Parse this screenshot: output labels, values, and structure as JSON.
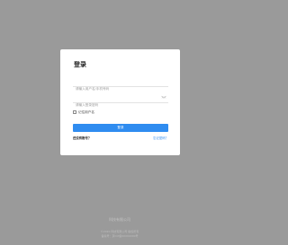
{
  "login": {
    "title": "登录",
    "account_placeholder": "请输入用户名/手机号码",
    "password_placeholder": "请输入登录密码",
    "remember_label": "记住用户名",
    "login_button": "登录",
    "register_prompt": "还没有账号？",
    "forgot_link": "忘记密码？"
  },
  "footer": {
    "brand": "科技有限公司",
    "copyright_line1": "©2020 科技有限公司 版权所有",
    "copyright_line2": "备案号：京ICP备00000000号"
  },
  "colors": {
    "background": "#9a9a9a",
    "accent": "#2f8cf0"
  },
  "icons": {
    "password_toggle": "eye-closed-icon"
  }
}
